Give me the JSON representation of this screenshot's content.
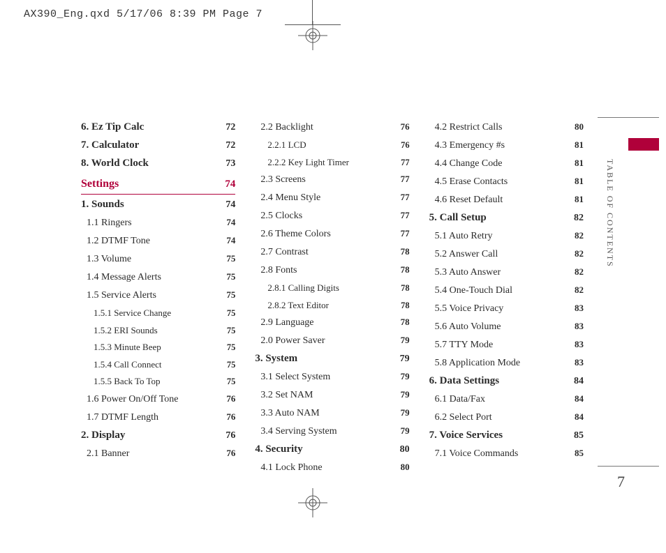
{
  "header": {
    "text": "AX390_Eng.qxd  5/17/06  8:39 PM  Page 7"
  },
  "sidebar": {
    "label": "TABLE OF CONTENTS",
    "page_number": "7"
  },
  "columns": [
    {
      "entries": [
        {
          "level": "lvl1",
          "label": "6. Ez Tip Calc",
          "page": "72"
        },
        {
          "level": "lvl1",
          "label": "7. Calculator",
          "page": "72"
        },
        {
          "level": "lvl1",
          "label": "8. World Clock",
          "page": "73"
        },
        {
          "level": "sec",
          "label": "Settings",
          "page": "74"
        },
        {
          "level": "lvl1",
          "label": "1. Sounds",
          "page": "74"
        },
        {
          "level": "lvl2",
          "label": "1.1 Ringers",
          "page": "74"
        },
        {
          "level": "lvl2",
          "label": "1.2 DTMF Tone",
          "page": "74"
        },
        {
          "level": "lvl2",
          "label": "1.3 Volume",
          "page": "75"
        },
        {
          "level": "lvl2",
          "label": "1.4 Message Alerts",
          "page": "75"
        },
        {
          "level": "lvl2",
          "label": "1.5 Service Alerts",
          "page": "75"
        },
        {
          "level": "lvl3",
          "label": "1.5.1 Service Change",
          "page": "75"
        },
        {
          "level": "lvl3",
          "label": "1.5.2 ERI Sounds",
          "page": "75"
        },
        {
          "level": "lvl3",
          "label": "1.5.3 Minute Beep",
          "page": "75"
        },
        {
          "level": "lvl3",
          "label": "1.5.4 Call Connect",
          "page": "75"
        },
        {
          "level": "lvl3",
          "label": "1.5.5 Back To Top",
          "page": "75"
        },
        {
          "level": "lvl2",
          "label": "1.6 Power On/Off Tone",
          "page": "76"
        },
        {
          "level": "lvl2",
          "label": "1.7 DTMF Length",
          "page": "76"
        },
        {
          "level": "lvl1",
          "label": "2. Display",
          "page": "76"
        },
        {
          "level": "lvl2",
          "label": "2.1 Banner",
          "page": "76"
        }
      ]
    },
    {
      "entries": [
        {
          "level": "lvl2",
          "label": "2.2 Backlight",
          "page": "76"
        },
        {
          "level": "lvl3",
          "label": "2.2.1 LCD",
          "page": "76"
        },
        {
          "level": "lvl3",
          "label": "2.2.2 Key Light Timer",
          "page": "77"
        },
        {
          "level": "lvl2",
          "label": "2.3 Screens",
          "page": "77"
        },
        {
          "level": "lvl2",
          "label": "2.4 Menu Style",
          "page": "77"
        },
        {
          "level": "lvl2",
          "label": "2.5 Clocks",
          "page": "77"
        },
        {
          "level": "lvl2",
          "label": "2.6 Theme Colors",
          "page": "77"
        },
        {
          "level": "lvl2",
          "label": "2.7 Contrast",
          "page": "78"
        },
        {
          "level": "lvl2",
          "label": "2.8 Fonts",
          "page": "78"
        },
        {
          "level": "lvl3",
          "label": "2.8.1 Calling Digits",
          "page": "78"
        },
        {
          "level": "lvl3",
          "label": "2.8.2 Text Editor",
          "page": "78"
        },
        {
          "level": "lvl2",
          "label": "2.9 Language",
          "page": "78"
        },
        {
          "level": "lvl2",
          "label": "2.0 Power Saver",
          "page": "79"
        },
        {
          "level": "lvl1",
          "label": "3. System",
          "page": "79"
        },
        {
          "level": "lvl2",
          "label": "3.1 Select System",
          "page": "79"
        },
        {
          "level": "lvl2",
          "label": "3.2 Set NAM",
          "page": "79"
        },
        {
          "level": "lvl2",
          "label": "3.3 Auto NAM",
          "page": "79"
        },
        {
          "level": "lvl2",
          "label": "3.4 Serving System",
          "page": "79"
        },
        {
          "level": "lvl1",
          "label": "4. Security",
          "page": "80"
        },
        {
          "level": "lvl2",
          "label": "4.1 Lock Phone",
          "page": "80"
        }
      ]
    },
    {
      "entries": [
        {
          "level": "lvl2",
          "label": "4.2 Restrict Calls",
          "page": "80"
        },
        {
          "level": "lvl2",
          "label": "4.3 Emergency #s",
          "page": "81"
        },
        {
          "level": "lvl2",
          "label": "4.4 Change Code",
          "page": "81"
        },
        {
          "level": "lvl2",
          "label": "4.5 Erase Contacts",
          "page": "81"
        },
        {
          "level": "lvl2",
          "label": "4.6 Reset Default",
          "page": "81"
        },
        {
          "level": "lvl1",
          "label": "5. Call Setup",
          "page": "82"
        },
        {
          "level": "lvl2",
          "label": "5.1 Auto Retry",
          "page": "82"
        },
        {
          "level": "lvl2",
          "label": "5.2 Answer Call",
          "page": "82"
        },
        {
          "level": "lvl2",
          "label": "5.3 Auto Answer",
          "page": "82"
        },
        {
          "level": "lvl2",
          "label": "5.4 One-Touch Dial",
          "page": "82"
        },
        {
          "level": "lvl2",
          "label": "5.5 Voice Privacy",
          "page": "83"
        },
        {
          "level": "lvl2",
          "label": "5.6 Auto Volume",
          "page": "83"
        },
        {
          "level": "lvl2",
          "label": "5.7 TTY Mode",
          "page": "83"
        },
        {
          "level": "lvl2",
          "label": "5.8 Application Mode",
          "page": "83"
        },
        {
          "level": "lvl1",
          "label": "6. Data Settings",
          "page": "84"
        },
        {
          "level": "lvl2",
          "label": "6.1 Data/Fax",
          "page": "84"
        },
        {
          "level": "lvl2",
          "label": "6.2 Select Port",
          "page": "84"
        },
        {
          "level": "lvl1",
          "label": "7. Voice Services",
          "page": "85"
        },
        {
          "level": "lvl2",
          "label": "7.1 Voice Commands",
          "page": "85"
        }
      ]
    }
  ]
}
